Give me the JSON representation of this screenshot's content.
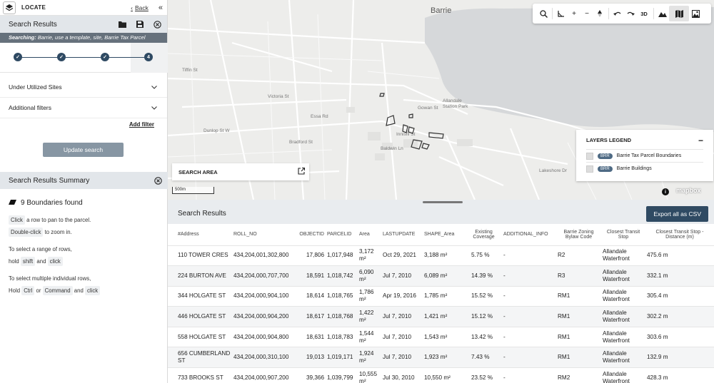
{
  "sidebar": {
    "app_title": "LOCATE",
    "back_label": "Back",
    "search_results_title": "Search Results",
    "searching_prefix": "Searching:",
    "searching_text": "Barrie, use a template, site, Barrie Tax Parcel",
    "steps": [
      "",
      "",
      "",
      "4"
    ],
    "filters": [
      {
        "label": "Under Utilized Sites"
      },
      {
        "label": "Additional filters"
      }
    ],
    "add_filter_label": "Add filter",
    "update_button": "Update search",
    "summary_title": "Search Results Summary",
    "found_text": "9 Boundaries found",
    "hints": {
      "h1_key": "Click",
      "h1_text": "a row to pan to the parcel.",
      "h2_key": "Double-click",
      "h2_text": "to zoom in.",
      "h3_text": "To select a range of rows,",
      "h4_pre": "hold",
      "h4_key1": "shift",
      "h4_and": "and",
      "h4_key2": "click",
      "h5_text": "To select multiple individual rows,",
      "h6_pre": "Hold",
      "h6_key1": "Ctrl",
      "h6_or": "or",
      "h6_key2": "Command",
      "h6_and": "and",
      "h6_key3": "click"
    }
  },
  "map": {
    "city": "Barrie",
    "label_park": "Allandale\nStation Park",
    "toolbar_3d": "3D",
    "search_area_label": "SEARCH AREA",
    "scale_label": "500m",
    "legend": {
      "title": "LAYERS LEGEND",
      "items": [
        {
          "tag": "BRR",
          "label": "Barrie Tax Parcel Boundaries"
        },
        {
          "tag": "BRR",
          "label": "Barrie Buildings"
        }
      ]
    },
    "attribution": "mapbox",
    "street_labels": [
      "Dunlop St W",
      "Bradford St",
      "Essa Rd",
      "Gowan St",
      "Innisfil St",
      "Baldwin Ln",
      "Tiffin St",
      "Lakeshore Dr",
      "Victoria St"
    ]
  },
  "results": {
    "title": "Search Results",
    "export_label": "Export all as CSV",
    "columns": [
      "#Address",
      "ROLL_NO",
      "OBJECTID",
      "PARCELID",
      "Area",
      "LASTUPDATE",
      "SHAPE_Area",
      "Existing Coverage",
      "ADDITIONAL_INFO",
      "Barrie Zoning Bylaw Code",
      "Closest Transit Stop",
      "Closest Transit Stop - Distance (m)"
    ],
    "rows": [
      [
        "110 TOWER CRES",
        "434,204,001,302,800",
        "17,806",
        "1,017,948",
        "3,172 m²",
        "Oct 29, 2021",
        "3,188 m²",
        "5.75 %",
        "-",
        "R2",
        "Allandale Waterfront",
        "475.6 m"
      ],
      [
        "224 BURTON AVE",
        "434,204,000,707,700",
        "18,591",
        "1,018,742",
        "6,090 m²",
        "Jul 7, 2010",
        "6,089 m²",
        "14.39 %",
        "-",
        "R3",
        "Allandale Waterfront",
        "332.1 m"
      ],
      [
        "344 HOLGATE ST",
        "434,204,000,904,100",
        "18,614",
        "1,018,765",
        "1,786 m²",
        "Apr 19, 2016",
        "1,785 m²",
        "15.52 %",
        "-",
        "RM1",
        "Allandale Waterfront",
        "305.4 m"
      ],
      [
        "446 HOLGATE ST",
        "434,204,000,904,200",
        "18,617",
        "1,018,768",
        "1,422 m²",
        "Jul 7, 2010",
        "1,421 m²",
        "15.12 %",
        "-",
        "RM1",
        "Allandale Waterfront",
        "302.2 m"
      ],
      [
        "558 HOLGATE ST",
        "434,204,000,904,800",
        "18,631",
        "1,018,783",
        "1,544 m²",
        "Jul 7, 2010",
        "1,543 m²",
        "13.42 %",
        "-",
        "RM1",
        "Allandale Waterfront",
        "303.6 m"
      ],
      [
        "656 CUMBERLAND ST",
        "434,204,000,310,100",
        "19,013",
        "1,019,171",
        "1,924 m²",
        "Jul 7, 2010",
        "1,923 m²",
        "7.43 %",
        "-",
        "RM1",
        "Allandale Waterfront",
        "132.9 m"
      ],
      [
        "733 BROOKS ST",
        "434,204,000,907,200",
        "39,366",
        "1,039,799",
        "10,555 m²",
        "Jul 30, 2010",
        "10,550 m²",
        "23.52 %",
        "-",
        "RM2",
        "Allandale Waterfront",
        "428.3 m"
      ]
    ]
  },
  "colors": {
    "primary": "#2f4a63",
    "header_bg": "#e2e6ea",
    "searching_bg": "#66717c",
    "button_disabled": "#8796a3",
    "water": "#d6d8da"
  }
}
